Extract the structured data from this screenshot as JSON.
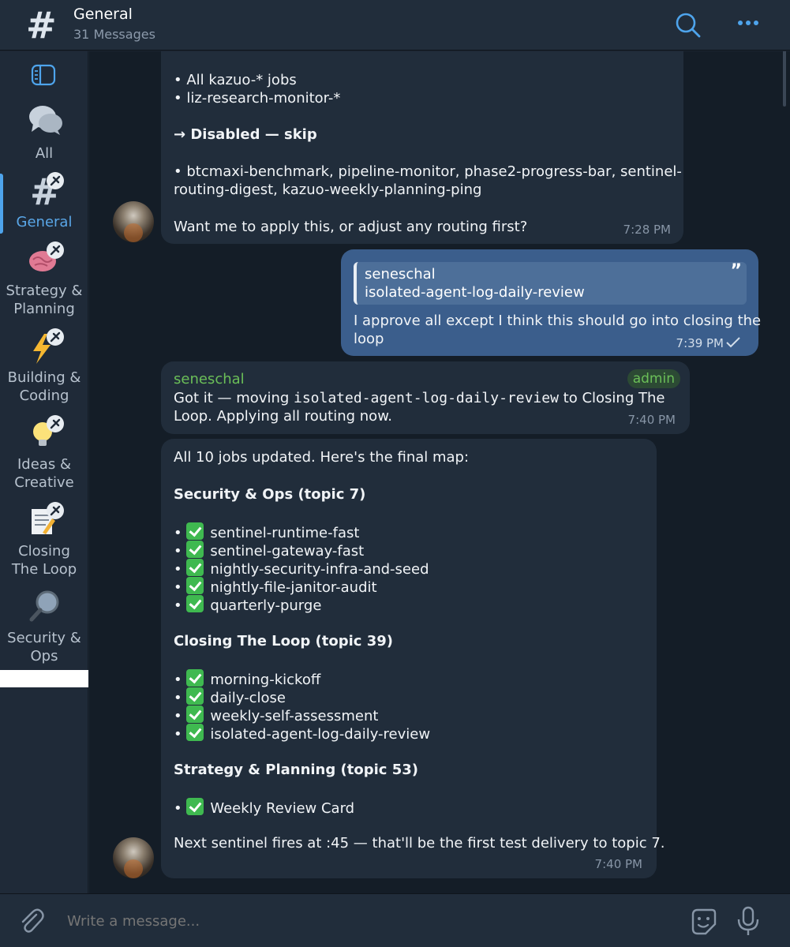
{
  "header": {
    "title": "General",
    "subtitle": "31 Messages"
  },
  "sidebar": {
    "items": [
      {
        "label": "All",
        "icon": "chat-bubbles-icon"
      },
      {
        "label": "General",
        "icon": "hash-icon",
        "active": true
      },
      {
        "label": "Strategy &\nPlanning",
        "icon": "brain-icon"
      },
      {
        "label": "Building &\nCoding",
        "icon": "lightning-icon"
      },
      {
        "label": "Ideas &\nCreative",
        "icon": "lightbulb-icon"
      },
      {
        "label": "Closing\nThe Loop",
        "icon": "memo-icon"
      },
      {
        "label": "Security &\nOps",
        "icon": "magnifier-icon"
      }
    ]
  },
  "messages": {
    "m1": {
      "lines": [
        "• All kazuo-* jobs",
        "• liz-research-monitor-*",
        "→ Disabled — skip",
        "• btcmaxi-benchmark, pipeline-monitor, phase2-progress-bar, sentinel-",
        "routing-digest, kazuo-weekly-planning-ping",
        "Want me to apply this, or adjust any routing first?"
      ],
      "time": "7:28 PM"
    },
    "m2": {
      "reply_name": "seneschal",
      "reply_text": "isolated-agent-log-daily-review",
      "lines": [
        "I approve all except I think this should go into closing the",
        "loop"
      ],
      "time": "7:39 PM"
    },
    "m3": {
      "sender": "seneschal",
      "badge": "admin",
      "text_a": "Got it — moving ",
      "code": "isolated-agent-log-daily-review",
      "text_b": " to Closing The",
      "line2": "Loop. Applying all routing now.",
      "time": "7:40 PM"
    },
    "m4": {
      "intro": "All 10 jobs updated. Here's the final map:",
      "sec1": "Security & Ops (topic 7)",
      "sec1_items": [
        "sentinel-runtime-fast",
        "sentinel-gateway-fast",
        "nightly-security-infra-and-seed",
        "nightly-file-janitor-audit",
        "quarterly-purge"
      ],
      "sec2": "Closing The Loop (topic 39)",
      "sec2_items": [
        "morning-kickoff",
        "daily-close",
        "weekly-self-assessment",
        "isolated-agent-log-daily-review"
      ],
      "sec3": "Strategy & Planning (topic 53)",
      "sec3_items": [
        "Weekly Review Card"
      ],
      "outro": "Next sentinel fires at :45 — that'll be the first test delivery to topic 7.",
      "time": "7:40 PM"
    }
  },
  "composer": {
    "placeholder": "Write a message..."
  },
  "colors": {
    "accent": "#4ea4ec",
    "outgoing_bubble": "#3b5e8c",
    "incoming_bubble": "#212d3b",
    "sender_green": "#6bbf58"
  }
}
